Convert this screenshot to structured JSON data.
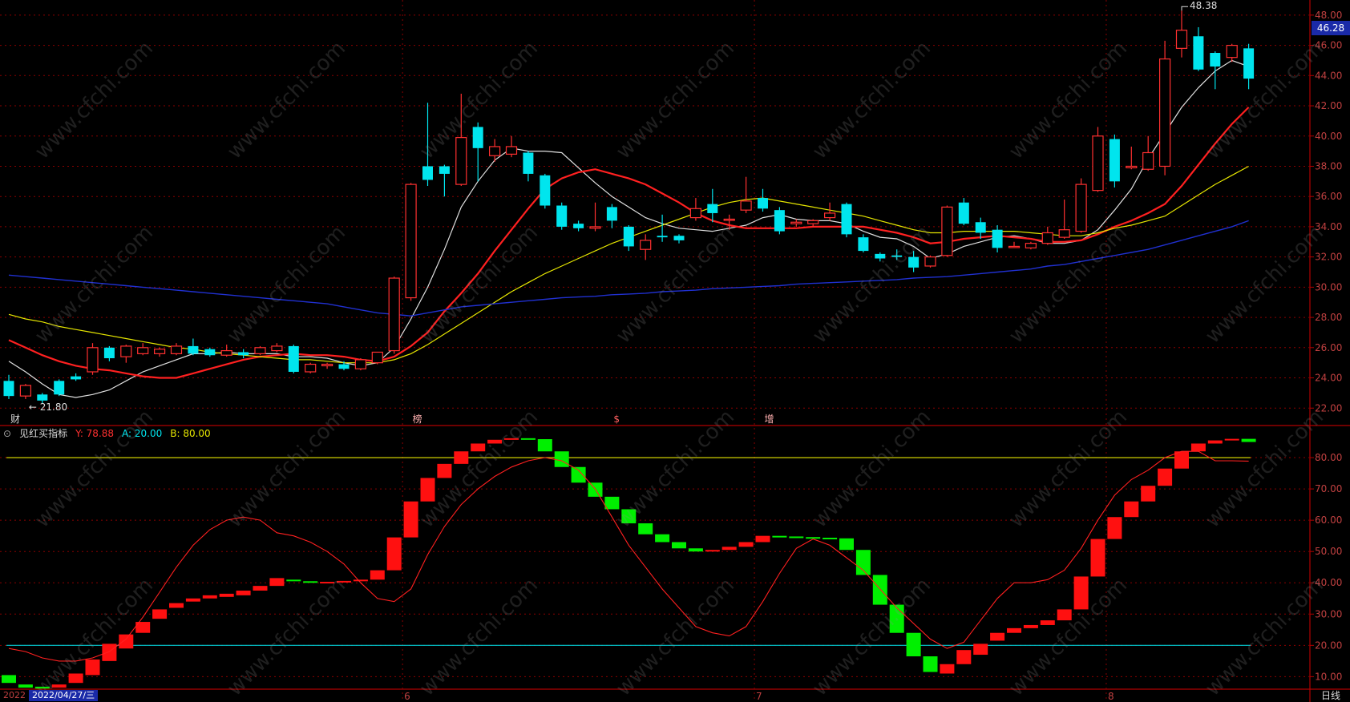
{
  "header": {
    "indicator_name": "见红买指标",
    "y_label": "Y: 78.88",
    "a_label": "A: 20.00",
    "b_label": "B: 80.00"
  },
  "price_tag": "46.28",
  "date_tag": "2022/04/27/三",
  "year_tag": "2022",
  "period": "日线",
  "markers": {
    "high": "48.38",
    "low": "21.80",
    "caption_1": "财",
    "caption_2": "榜",
    "caption_3": "$",
    "caption_4": "增"
  },
  "watermark": "www.cfchi.com",
  "colors": {
    "up": "#ff3030",
    "down": "#00e5ee",
    "ma5": "#e0e0e0",
    "ma10": "#ff2020",
    "ma20": "#e6e600",
    "ma60": "#2030d0",
    "ind_up": "#ff1010",
    "ind_down": "#00f000",
    "grid": "#8b0000"
  },
  "chart_data": [
    {
      "type": "candlestick",
      "ylim": [
        20.9,
        49.0
      ],
      "y_ticks": [
        "22.00",
        "24.00",
        "26.00",
        "28.00",
        "30.00",
        "32.00",
        "34.00",
        "36.00",
        "38.00",
        "40.00",
        "42.00",
        "44.00",
        "46.00",
        "48.00"
      ],
      "x_ticks": [
        {
          "label": "6",
          "index": 24
        },
        {
          "label": "7",
          "index": 45
        },
        {
          "label": "8",
          "index": 66
        }
      ],
      "candles": [
        [
          23.8,
          22.8,
          24.2,
          22.6
        ],
        [
          22.8,
          23.5,
          23.6,
          22.6
        ],
        [
          22.9,
          22.5,
          23.0,
          22.3
        ],
        [
          23.8,
          22.9,
          23.9,
          22.8
        ],
        [
          24.1,
          23.9,
          24.3,
          23.8
        ],
        [
          24.4,
          26.0,
          26.3,
          24.2
        ],
        [
          26.0,
          25.3,
          26.1,
          25.1
        ],
        [
          25.4,
          26.1,
          26.2,
          25.0
        ],
        [
          25.6,
          26.0,
          26.3,
          25.5
        ],
        [
          25.6,
          25.9,
          26.0,
          25.4
        ],
        [
          25.6,
          26.1,
          26.3,
          25.5
        ],
        [
          26.1,
          25.6,
          26.6,
          25.5
        ],
        [
          25.9,
          25.5,
          26.0,
          25.4
        ],
        [
          25.5,
          25.8,
          26.2,
          25.4
        ],
        [
          25.7,
          25.5,
          25.9,
          25.3
        ],
        [
          25.6,
          26.0,
          26.1,
          25.5
        ],
        [
          25.8,
          26.1,
          26.3,
          25.7
        ],
        [
          26.1,
          24.4,
          26.2,
          24.3
        ],
        [
          24.4,
          24.9,
          25.0,
          24.3
        ],
        [
          24.8,
          24.9,
          25.0,
          24.6
        ],
        [
          24.9,
          24.6,
          25.1,
          24.5
        ],
        [
          24.6,
          25.2,
          25.3,
          24.5
        ],
        [
          25.0,
          25.7,
          25.7,
          24.9
        ],
        [
          25.8,
          30.6,
          30.7,
          25.6
        ],
        [
          29.3,
          36.8,
          36.9,
          29.1
        ],
        [
          38.0,
          37.1,
          42.2,
          36.7
        ],
        [
          38.0,
          37.5,
          38.1,
          36.0
        ],
        [
          36.8,
          39.9,
          42.8,
          36.7
        ],
        [
          40.6,
          39.2,
          40.9,
          37.0
        ],
        [
          38.7,
          39.3,
          39.8,
          38.3
        ],
        [
          38.8,
          39.3,
          40.0,
          38.6
        ],
        [
          38.9,
          37.5,
          39.0,
          37.0
        ],
        [
          37.4,
          35.4,
          37.5,
          35.2
        ],
        [
          35.4,
          34.0,
          35.6,
          33.8
        ],
        [
          34.2,
          33.9,
          34.4,
          33.7
        ],
        [
          33.9,
          34.0,
          35.6,
          33.7
        ],
        [
          35.3,
          34.4,
          35.5,
          33.9
        ],
        [
          34.0,
          32.7,
          34.1,
          32.4
        ],
        [
          32.5,
          33.1,
          33.5,
          31.8
        ],
        [
          33.4,
          33.3,
          34.8,
          33.0
        ],
        [
          33.4,
          33.1,
          33.5,
          32.9
        ],
        [
          34.6,
          35.2,
          35.9,
          34.4
        ],
        [
          35.5,
          34.9,
          36.5,
          34.3
        ],
        [
          34.5,
          34.5,
          34.8,
          33.8
        ],
        [
          35.1,
          35.7,
          37.3,
          34.9
        ],
        [
          35.9,
          35.2,
          36.5,
          35.0
        ],
        [
          35.1,
          33.7,
          35.3,
          33.5
        ],
        [
          34.2,
          34.3,
          34.5,
          34.0
        ],
        [
          34.2,
          34.4,
          34.5,
          34.0
        ],
        [
          34.6,
          34.9,
          35.6,
          34.4
        ],
        [
          35.5,
          33.5,
          35.6,
          33.3
        ],
        [
          33.3,
          32.4,
          33.5,
          32.3
        ],
        [
          32.2,
          31.9,
          32.3,
          31.7
        ],
        [
          32.1,
          32.0,
          32.5,
          31.8
        ],
        [
          32.0,
          31.3,
          32.4,
          31.0
        ],
        [
          31.4,
          32.0,
          32.1,
          31.3
        ],
        [
          32.1,
          35.3,
          35.4,
          32.0
        ],
        [
          35.6,
          34.2,
          35.9,
          34.1
        ],
        [
          34.3,
          33.6,
          34.6,
          33.2
        ],
        [
          33.8,
          32.6,
          34.1,
          32.3
        ],
        [
          32.7,
          32.7,
          33.0,
          32.6
        ],
        [
          32.6,
          32.9,
          33.0,
          32.5
        ],
        [
          32.9,
          33.6,
          34.0,
          32.8
        ],
        [
          33.3,
          33.8,
          35.8,
          33.2
        ],
        [
          33.7,
          36.8,
          37.2,
          33.6
        ],
        [
          36.4,
          40.0,
          40.6,
          36.3
        ],
        [
          39.8,
          37.0,
          40.1,
          36.6
        ],
        [
          37.9,
          38.0,
          39.3,
          37.8
        ],
        [
          37.8,
          38.9,
          40.0,
          37.7
        ],
        [
          38.0,
          45.1,
          46.3,
          37.4
        ],
        [
          45.8,
          47.0,
          48.3,
          45.2
        ],
        [
          46.6,
          44.4,
          47.2,
          44.3
        ],
        [
          45.5,
          44.6,
          45.6,
          43.1
        ],
        [
          45.2,
          46.0,
          46.1,
          44.9
        ],
        [
          45.8,
          43.8,
          46.1,
          43.1
        ]
      ],
      "series": [
        {
          "name": "MA5",
          "values": [
            25.1,
            24.4,
            23.6,
            22.9,
            22.7,
            22.9,
            23.2,
            23.8,
            24.4,
            24.8,
            25.2,
            25.6,
            25.6,
            25.7,
            25.6,
            25.6,
            25.6,
            25.4,
            25.4,
            25.3,
            25.0,
            24.8,
            25.0,
            26.0,
            27.9,
            30.0,
            32.5,
            35.3,
            37.0,
            38.4,
            39.2,
            39.0,
            39.0,
            38.9,
            37.9,
            36.9,
            36.0,
            35.3,
            34.6,
            34.2,
            33.9,
            33.8,
            33.7,
            33.9,
            34.1,
            34.6,
            34.8,
            34.5,
            34.4,
            34.4,
            34.2,
            33.7,
            33.3,
            33.2,
            32.7,
            31.9,
            32.2,
            32.7,
            33.0,
            33.3,
            33.4,
            33.2,
            32.9,
            32.9,
            33.1,
            33.8,
            35.1,
            36.5,
            38.5,
            40.2,
            41.9,
            43.2,
            44.3,
            45.0,
            44.6
          ]
        },
        {
          "name": "MA10",
          "values": [
            26.5,
            26.0,
            25.5,
            25.1,
            24.8,
            24.6,
            24.5,
            24.3,
            24.1,
            24.0,
            24.0,
            24.3,
            24.6,
            24.9,
            25.2,
            25.4,
            25.5,
            25.6,
            25.5,
            25.5,
            25.4,
            25.2,
            25.1,
            25.4,
            26.1,
            27.0,
            28.4,
            29.6,
            30.9,
            32.4,
            33.8,
            35.2,
            36.5,
            37.2,
            37.6,
            37.8,
            37.5,
            37.2,
            36.8,
            36.2,
            35.6,
            34.9,
            34.4,
            34.1,
            33.9,
            33.9,
            33.9,
            33.9,
            34.0,
            34.0,
            34.0,
            34.0,
            33.8,
            33.6,
            33.3,
            32.9,
            33.0,
            33.2,
            33.3,
            33.4,
            33.3,
            33.2,
            33.0,
            33.0,
            33.1,
            33.5,
            34.0,
            34.4,
            34.9,
            35.5,
            36.7,
            38.1,
            39.5,
            40.8,
            41.9
          ]
        },
        {
          "name": "MA20",
          "values": [
            28.2,
            27.9,
            27.7,
            27.4,
            27.2,
            27.0,
            26.8,
            26.6,
            26.4,
            26.2,
            26.0,
            25.9,
            25.7,
            25.6,
            25.5,
            25.4,
            25.3,
            25.2,
            25.2,
            25.1,
            25.0,
            25.0,
            25.0,
            25.2,
            25.6,
            26.2,
            26.9,
            27.6,
            28.3,
            29.0,
            29.7,
            30.3,
            30.9,
            31.4,
            31.9,
            32.4,
            32.9,
            33.3,
            33.7,
            34.1,
            34.5,
            34.9,
            35.3,
            35.6,
            35.8,
            35.9,
            35.7,
            35.5,
            35.3,
            35.1,
            34.9,
            34.7,
            34.4,
            34.1,
            33.8,
            33.6,
            33.6,
            33.7,
            33.7,
            33.7,
            33.7,
            33.6,
            33.5,
            33.4,
            33.4,
            33.6,
            33.9,
            34.1,
            34.4,
            34.7,
            35.4,
            36.1,
            36.8,
            37.4,
            38.0
          ]
        },
        {
          "name": "MA60",
          "values": [
            30.8,
            30.7,
            30.6,
            30.5,
            30.4,
            30.3,
            30.2,
            30.1,
            30.0,
            29.9,
            29.8,
            29.7,
            29.6,
            29.5,
            29.4,
            29.3,
            29.2,
            29.1,
            29.0,
            28.9,
            28.7,
            28.5,
            28.3,
            28.2,
            28.1,
            28.3,
            28.5,
            28.7,
            28.8,
            28.9,
            29.0,
            29.1,
            29.2,
            29.3,
            29.35,
            29.4,
            29.5,
            29.55,
            29.6,
            29.7,
            29.75,
            29.8,
            29.9,
            29.95,
            30.0,
            30.05,
            30.1,
            30.2,
            30.25,
            30.3,
            30.35,
            30.4,
            30.45,
            30.5,
            30.6,
            30.65,
            30.7,
            30.8,
            30.9,
            31.0,
            31.1,
            31.2,
            31.4,
            31.5,
            31.7,
            31.9,
            32.1,
            32.3,
            32.5,
            32.8,
            33.1,
            33.4,
            33.7,
            34.0,
            34.4
          ]
        }
      ]
    },
    {
      "type": "bar+line",
      "ylim": [
        6,
        90
      ],
      "y_ticks": [
        "10.00",
        "20.00",
        "30.00",
        "40.00",
        "50.00",
        "60.00",
        "70.00",
        "80.00"
      ],
      "reference_lines": [
        {
          "name": "A",
          "value": 20.0
        },
        {
          "name": "B",
          "value": 80.0
        }
      ],
      "bars": [
        [
          10.5,
          8.0
        ],
        [
          7.5,
          6.5
        ],
        [
          6.8,
          6.2
        ],
        [
          6.5,
          7.5
        ],
        [
          8.0,
          11.0
        ],
        [
          10.5,
          15.5
        ],
        [
          15.0,
          20.5
        ],
        [
          19.0,
          23.5
        ],
        [
          24.0,
          27.5
        ],
        [
          28.5,
          31.5
        ],
        [
          32.0,
          33.5
        ],
        [
          34.0,
          35.0
        ],
        [
          35.0,
          36.0
        ],
        [
          35.5,
          36.5
        ],
        [
          36.0,
          37.5
        ],
        [
          37.5,
          39.0
        ],
        [
          39.0,
          41.5
        ],
        [
          41.0,
          40.5
        ],
        [
          40.5,
          40.0
        ],
        [
          40.0,
          40.3
        ],
        [
          40.3,
          40.6
        ],
        [
          40.6,
          41.0
        ],
        [
          41.0,
          44.0
        ],
        [
          44.0,
          54.5
        ],
        [
          54.5,
          66.0
        ],
        [
          66.0,
          73.5
        ],
        [
          73.5,
          78.0
        ],
        [
          78.0,
          82.0
        ],
        [
          82.0,
          84.5
        ],
        [
          84.5,
          85.7
        ],
        [
          85.7,
          86.2
        ],
        [
          86.2,
          85.9
        ],
        [
          85.9,
          82.0
        ],
        [
          82.0,
          77.0
        ],
        [
          77.0,
          72.0
        ],
        [
          72.0,
          67.5
        ],
        [
          67.5,
          63.5
        ],
        [
          63.5,
          59.0
        ],
        [
          59.0,
          55.5
        ],
        [
          55.5,
          53.0
        ],
        [
          53.0,
          51.0
        ],
        [
          51.0,
          50.0
        ],
        [
          50.0,
          50.5
        ],
        [
          50.5,
          51.5
        ],
        [
          51.5,
          53.0
        ],
        [
          53.0,
          55.0
        ],
        [
          55.0,
          54.8
        ],
        [
          54.8,
          54.6
        ],
        [
          54.6,
          54.4
        ],
        [
          54.4,
          54.2
        ],
        [
          54.2,
          50.5
        ],
        [
          50.5,
          42.5
        ],
        [
          42.5,
          33.0
        ],
        [
          33.0,
          24.0
        ],
        [
          24.0,
          16.5
        ],
        [
          16.5,
          11.5
        ],
        [
          11.0,
          14.0
        ],
        [
          14.0,
          18.5
        ],
        [
          17.0,
          20.5
        ],
        [
          21.5,
          24.0
        ],
        [
          24.0,
          25.5
        ],
        [
          25.5,
          26.5
        ],
        [
          26.5,
          28.0
        ],
        [
          28.0,
          31.5
        ],
        [
          31.5,
          42.0
        ],
        [
          42.0,
          54.0
        ],
        [
          54.0,
          61.0
        ],
        [
          61.0,
          66.0
        ],
        [
          66.0,
          71.0
        ],
        [
          71.0,
          76.5
        ],
        [
          76.5,
          82.0
        ],
        [
          82.0,
          84.5
        ],
        [
          84.5,
          85.5
        ],
        [
          85.5,
          86.0
        ],
        [
          86.0,
          85.0
        ]
      ],
      "line": [
        19,
        18,
        16,
        15,
        15,
        16,
        18,
        22,
        29,
        37,
        45,
        52,
        57,
        60,
        61,
        60,
        56,
        55,
        53,
        50,
        46,
        40,
        35,
        34,
        38,
        49,
        58,
        65,
        70,
        74,
        77,
        79,
        80,
        79,
        76,
        70,
        61,
        52,
        45,
        38,
        32,
        26,
        24,
        23,
        26,
        34,
        43,
        51,
        54,
        52,
        48,
        44,
        38,
        32,
        27,
        22,
        19,
        21,
        28,
        35,
        40,
        40,
        41,
        44,
        51,
        60,
        68,
        73,
        76,
        80,
        82,
        82,
        79,
        79,
        78.88
      ]
    }
  ]
}
